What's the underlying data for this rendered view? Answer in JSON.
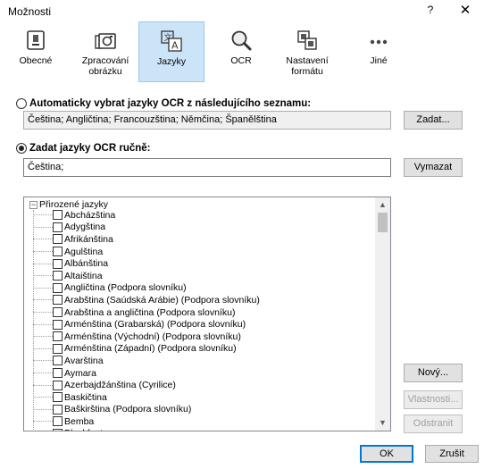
{
  "window": {
    "title": "Možnosti",
    "help_glyph": "?",
    "close_glyph": "✕"
  },
  "toolbar": {
    "items": [
      {
        "label": "Obecné",
        "icon": "general-icon"
      },
      {
        "label": "Zpracování obrázku",
        "icon": "image-processing-icon"
      },
      {
        "label": "Jazyky",
        "icon": "languages-icon",
        "selected": true
      },
      {
        "label": "OCR",
        "icon": "ocr-magnifier-icon"
      },
      {
        "label": "Nastavení formátu",
        "icon": "format-settings-icon"
      },
      {
        "label": "Jiné",
        "icon": "more-icon"
      }
    ]
  },
  "auto": {
    "label": "Automaticky vybrat jazyky OCR z následujícího seznamu:",
    "value": "Čeština; Angličtina; Francouzština; Němčina; Španělština",
    "button": "Zadat...",
    "selected": false
  },
  "manual": {
    "label": "Zadat jazyky OCR ručně:",
    "value": "Čeština;",
    "button": "Vymazat",
    "selected": true
  },
  "tree": {
    "root_label": "Přirozené jazyky",
    "expander": "−",
    "items": [
      "Abcházština",
      "Adygština",
      "Afrikánština",
      "Agulština",
      "Albánština",
      "Altaiština",
      "Angličtina (Podpora slovníku)",
      "Arabština (Saúdská Arábie) (Podpora slovníku)",
      "Arabština a angličtina (Podpora slovníku)",
      "Arménština (Grabarská) (Podpora slovníku)",
      "Arménština (Východní) (Podpora slovníku)",
      "Arménština (Západní) (Podpora slovníku)",
      "Avarština",
      "Aymara",
      "Azerbajdžánština (Cyrilice)",
      "Baskičtina",
      "Baškirština (Podpora slovníku)",
      "Bemba",
      "Blackfoot"
    ],
    "scroll_up": "▲",
    "scroll_down": "▼"
  },
  "side_buttons": {
    "new": "Nový...",
    "properties": "Vlastnosti...",
    "remove": "Odstranit"
  },
  "footer": {
    "ok": "OK",
    "cancel": "Zrušit"
  },
  "colors": {
    "selected_bg": "#cce4f7",
    "selected_border": "#99c9ef",
    "accent": "#0078d7"
  }
}
